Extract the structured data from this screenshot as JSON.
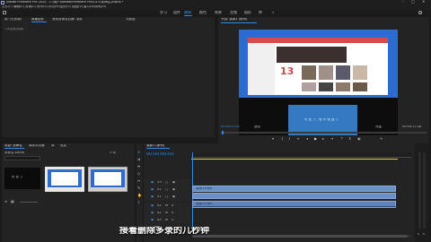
{
  "app": {
    "title": "Adobe Premiere Pro 2020 - C:\\用户\\Adobe\\Premiere Pro\\14.0\\未命名.prproj *",
    "menu": [
      "文件(F)",
      "编辑(E)",
      "剪辑(C)",
      "序列(S)",
      "标记(M)",
      "图形(G)",
      "视图(V)",
      "窗口(W)",
      "帮助(H)"
    ],
    "workspaces": [
      "学习",
      "组件",
      "编辑",
      "颜色",
      "效果",
      "音频",
      "图形",
      "库"
    ],
    "active_workspace": "编辑"
  },
  "source_panel": {
    "tabs": [
      "源: (无剪辑)",
      "效果控件",
      "音频剪辑混合器: 录屏",
      "元数据"
    ],
    "active_tab": "效果控件",
    "message": "(未选择剪辑)"
  },
  "program_monitor": {
    "title": "节目: 录屏1 (序列)",
    "left_timecode": "00:00:00:00",
    "fit_label": "适合",
    "zoom_label": "完整",
    "right_timecode": "00:04:11:28"
  },
  "video_frame": {
    "big_number": "13",
    "lower_text": "失 业 了 , 也 不 想 活 了"
  },
  "project_panel": {
    "tabs": [
      "项目: 未命名",
      "媒体浏览器",
      "库",
      "信息"
    ],
    "bin": "未命名.prproj",
    "thumb_caption": "失 业 了",
    "item_count": "3 项"
  },
  "timeline": {
    "tab": "录屏1 (序列)",
    "timecode": "00:00:00:00",
    "tracks": [
      {
        "name": "V3",
        "type": "video"
      },
      {
        "name": "V2",
        "type": "video"
      },
      {
        "name": "V1",
        "type": "video"
      },
      {
        "name": "A1",
        "type": "audio"
      },
      {
        "name": "A2",
        "type": "audio"
      },
      {
        "name": "A3",
        "type": "audio"
      }
    ],
    "clips": {
      "v1": "录屏1.mp4",
      "a1": "录屏1.mp4"
    },
    "master_label": "主声道"
  },
  "subtitle": "接着删除多录的几秒钟",
  "colors": {
    "accent": "#2d8ceb",
    "clip": "#6b8fc6",
    "playhead": "#2d8ceb",
    "work_area": "#e0d048"
  }
}
